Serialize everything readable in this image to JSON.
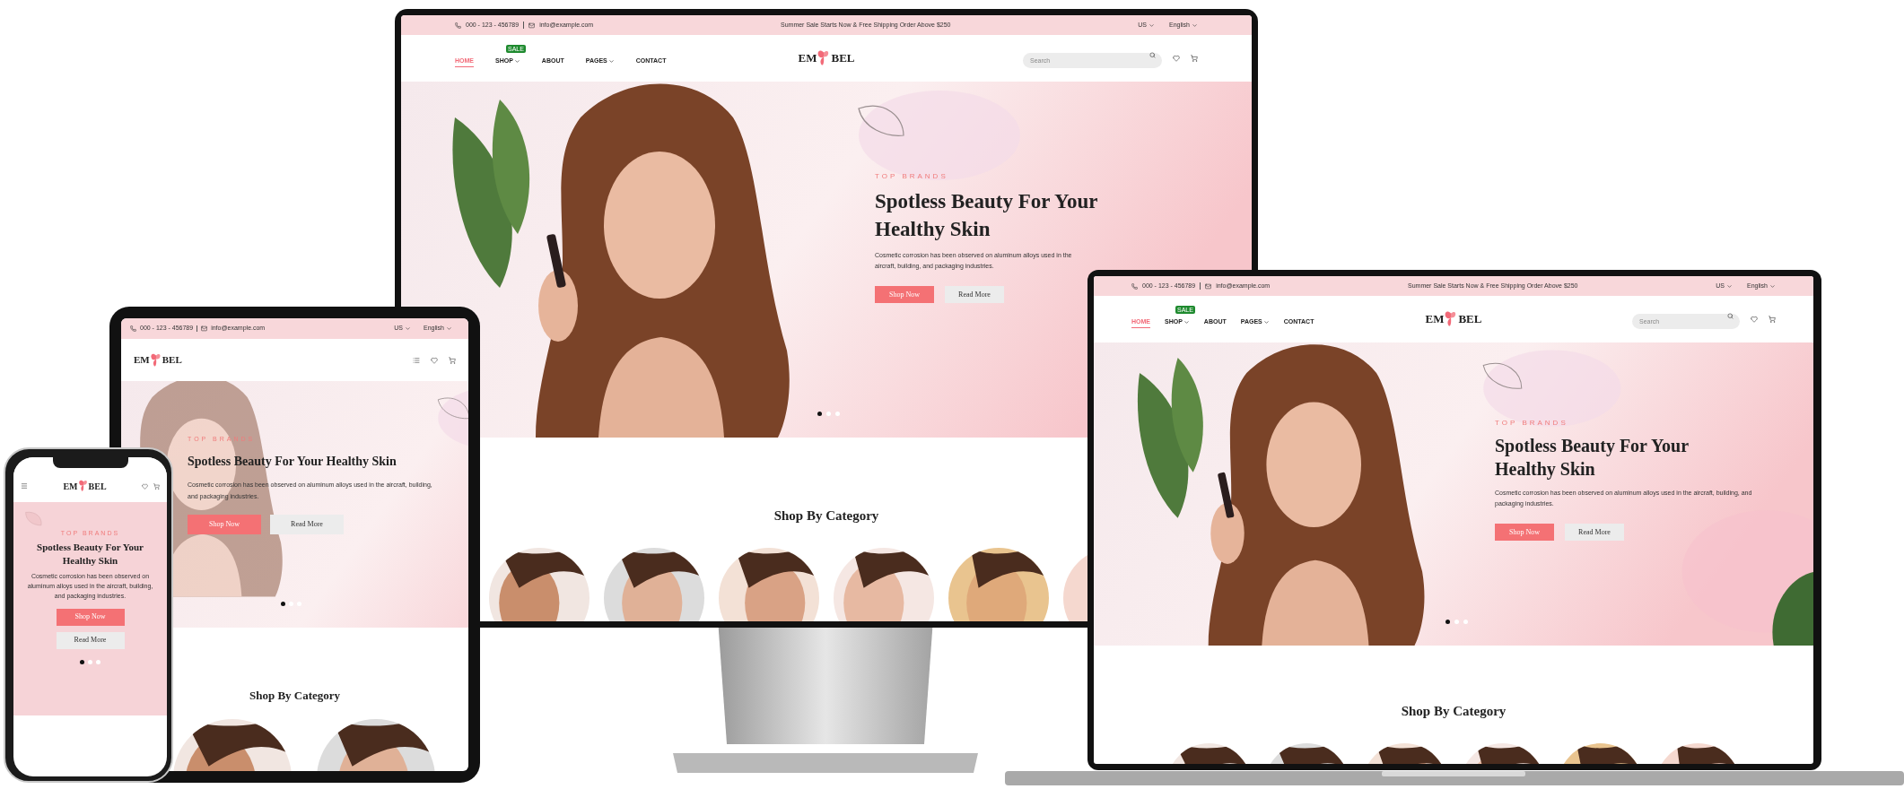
{
  "devices": [
    {
      "kind": "monitor",
      "site": {
        "top_bar": {
          "phone": "000 - 123 - 456789",
          "email": "info@example.com",
          "promo": "Summer Sale Starts Now & Free Shipping Order Above $250",
          "currency": "US",
          "language": "English"
        },
        "logo": [
          "EM",
          "BEL"
        ],
        "nav": [
          {
            "label": "HOME",
            "selected": true,
            "dropdown": false
          },
          {
            "label": "SHOP",
            "selected": false,
            "dropdown": true,
            "badge": "SALE"
          },
          {
            "label": "ABOUT",
            "selected": false,
            "dropdown": false
          },
          {
            "label": "PAGES",
            "selected": false,
            "dropdown": true
          },
          {
            "label": "CONTACT",
            "selected": false,
            "dropdown": false
          }
        ],
        "search": {
          "placeholder": "Search"
        },
        "hero": {
          "eyebrow": "TOP BRANDS",
          "heading": "Spotless Beauty For Your Healthy Skin",
          "text": "Cosmetic corrosion has been observed on aluminum alloys used in the aircraft, building, and packaging industries.",
          "buttons": [
            {
              "label": "Shop Now",
              "kind": "primary"
            },
            {
              "label": "Read More",
              "kind": "secondary"
            }
          ],
          "dots": [
            {
              "selected": true
            },
            {
              "selected": false
            },
            {
              "selected": false
            }
          ]
        },
        "section_title": "Shop By Category",
        "categories": [
          {
            "kind": "picture"
          },
          {
            "kind": "picture"
          },
          {
            "kind": "picture"
          },
          {
            "kind": "picture"
          },
          {
            "kind": "picture"
          },
          {
            "kind": "picture"
          }
        ]
      }
    },
    {
      "kind": "laptop",
      "site": {
        "top_bar": {
          "phone": "000 - 123 - 456789",
          "email": "info@example.com",
          "promo": "Summer Sale Starts Now & Free Shipping Order Above $250",
          "currency": "US",
          "language": "English"
        },
        "logo": [
          "EM",
          "BEL"
        ],
        "nav": [
          {
            "label": "HOME",
            "selected": true,
            "dropdown": false
          },
          {
            "label": "SHOP",
            "selected": false,
            "dropdown": true,
            "badge": "SALE"
          },
          {
            "label": "ABOUT",
            "selected": false,
            "dropdown": false
          },
          {
            "label": "PAGES",
            "selected": false,
            "dropdown": true
          },
          {
            "label": "CONTACT",
            "selected": false,
            "dropdown": false
          }
        ],
        "search": {
          "placeholder": "Search"
        },
        "hero": {
          "eyebrow": "TOP BRANDS",
          "heading": "Spotless Beauty For Your Healthy Skin",
          "text": "Cosmetic corrosion has been observed on aluminum alloys used in the aircraft, building, and packaging industries.",
          "buttons": [
            {
              "label": "Shop Now",
              "kind": "primary"
            },
            {
              "label": "Read More",
              "kind": "secondary"
            }
          ],
          "dots": [
            {
              "selected": true
            },
            {
              "selected": false
            },
            {
              "selected": false
            }
          ]
        },
        "section_title": "Shop By Category",
        "categories": [
          {
            "kind": "picture"
          },
          {
            "kind": "picture"
          },
          {
            "kind": "picture"
          },
          {
            "kind": "picture"
          },
          {
            "kind": "picture"
          },
          {
            "kind": "picture"
          }
        ]
      }
    },
    {
      "kind": "tablet",
      "site": {
        "top_bar": {
          "phone": "000 - 123 - 456789",
          "email": "info@example.com",
          "currency": "US",
          "language": "English"
        },
        "logo": [
          "EM",
          "BEL"
        ],
        "hero": {
          "eyebrow": "TOP BRANDS",
          "heading": "Spotless Beauty For Your Healthy Skin",
          "text": "Cosmetic corrosion has been observed on aluminum alloys used in the aircraft, building, and packaging industries.",
          "buttons": [
            {
              "label": "Shop Now",
              "kind": "primary"
            },
            {
              "label": "Read More",
              "kind": "secondary"
            }
          ],
          "dots": [
            {
              "selected": true
            },
            {
              "selected": false
            },
            {
              "selected": false
            }
          ]
        },
        "section_title": "Shop By Category",
        "categories": [
          {
            "kind": "picture"
          },
          {
            "kind": "picture"
          }
        ]
      }
    },
    {
      "kind": "phone",
      "site": {
        "logo": [
          "EM",
          "BEL"
        ],
        "hero": {
          "eyebrow": "TOP BRANDS",
          "heading": "Spotless Beauty For Your Healthy Skin",
          "text": "Cosmetic corrosion has been observed on aluminum alloys used in the aircraft, building, and packaging industries.",
          "buttons": [
            {
              "label": "Shop Now",
              "kind": "primary"
            },
            {
              "label": "Read More",
              "kind": "secondary"
            }
          ],
          "dots": [
            {
              "selected": true
            },
            {
              "selected": false
            },
            {
              "selected": false
            }
          ]
        }
      }
    }
  ]
}
